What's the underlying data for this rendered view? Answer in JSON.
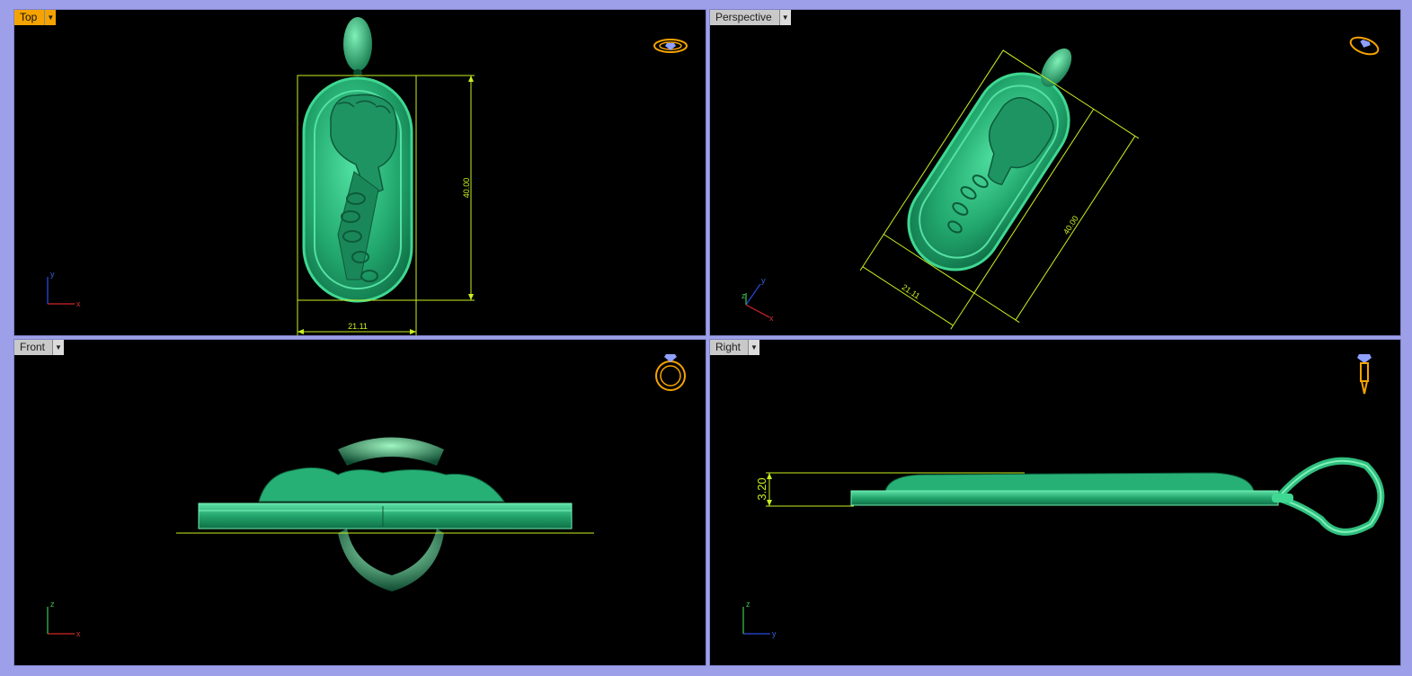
{
  "viewports": {
    "top": {
      "label": "Top",
      "width_dim": "21.11",
      "height_dim": "40.00",
      "axis_h": "x",
      "axis_v": "y"
    },
    "perspective": {
      "label": "Perspective",
      "width_dim": "21.11",
      "height_dim": "40.00",
      "axis_h": "x",
      "axis_v": "y",
      "axis_z": "z"
    },
    "front": {
      "label": "Front",
      "axis_h": "x",
      "axis_v": "z"
    },
    "right": {
      "label": "Right",
      "thickness_dim": "3.20",
      "axis_h": "y",
      "axis_v": "z"
    }
  },
  "icons": {
    "view_cube_top": "ring-top-view-icon",
    "view_cube_persp": "ring-perspective-icon",
    "view_cube_front": "ring-front-view-icon",
    "view_cube_right": "ring-side-view-icon",
    "dropdown": "chevron-down-icon"
  },
  "colors": {
    "model": "#2fbf7f",
    "dimension": "#c8f020",
    "active_tab": "#f5a300",
    "frame": "#9da0e8"
  }
}
